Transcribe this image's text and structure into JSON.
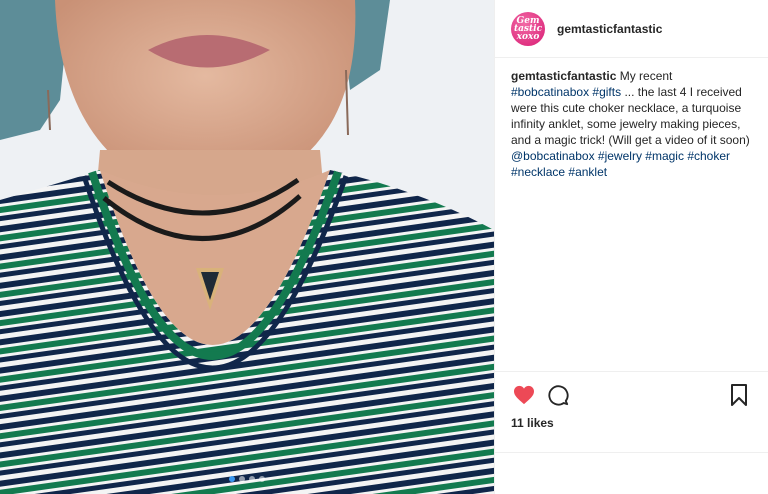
{
  "post": {
    "username": "gemtasticfantastic",
    "avatar_text": "Gem tastic xoxo",
    "caption": {
      "user": "gemtasticfantastic",
      "parts": [
        {
          "text": " My recent ",
          "tag": false
        },
        {
          "text": "#bobcatinabox",
          "tag": true
        },
        {
          "text": " ",
          "tag": false
        },
        {
          "text": "#gifts",
          "tag": true
        },
        {
          "text": " ... the last 4 I received were this cute choker necklace, a turquoise infinity anklet, some jewelry making pieces, and a magic trick! (Will get a video of it soon) ",
          "tag": false
        },
        {
          "text": "@bobcatinabox",
          "tag": true
        },
        {
          "text": " ",
          "tag": false
        },
        {
          "text": "#jewelry",
          "tag": true
        },
        {
          "text": " ",
          "tag": false
        },
        {
          "text": "#magic",
          "tag": true
        },
        {
          "text": " ",
          "tag": false
        },
        {
          "text": "#choker",
          "tag": true
        },
        {
          "text": " ",
          "tag": false
        },
        {
          "text": "#necklace",
          "tag": true
        },
        {
          "text": " ",
          "tag": false
        },
        {
          "text": "#anklet",
          "tag": true
        }
      ]
    },
    "likes_text": "11 likes",
    "carousel": {
      "count": 4,
      "active_index": 0
    },
    "icons": {
      "like": "heart-icon",
      "comment": "comment-icon",
      "save": "bookmark-icon"
    },
    "colors": {
      "like_red": "#ed4956",
      "hashtag": "#003569",
      "active_dot": "#3897f0"
    }
  }
}
